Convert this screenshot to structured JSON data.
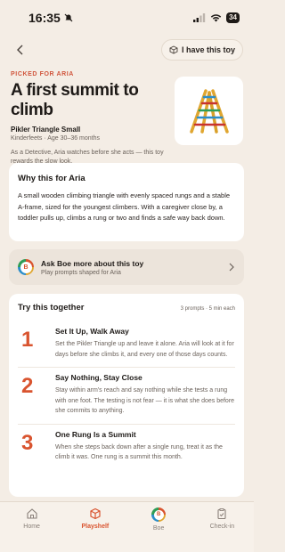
{
  "status": {
    "time": "16:35",
    "battery": "34"
  },
  "topbar": {
    "have_toy_label": "I have this toy"
  },
  "hero": {
    "eyebrow": "PICKED FOR ARIA",
    "title": "A first summit to climb",
    "product_name": "Pikler Triangle Small",
    "product_meta": "Kinderfeets · Age 30–36 months",
    "blurb": "As a Detective, Aria watches before she acts — this toy rewards the slow look."
  },
  "why": {
    "title": "Why this for Aria",
    "body": "A small wooden climbing triangle with evenly spaced rungs and a stable A-frame, sized for the youngest climbers. With a caregiver close by, a toddler pulls up, climbs a rung or two and finds a safe way back down."
  },
  "ask": {
    "title": "Ask Boe more about this toy",
    "subtitle": "Play prompts shaped for Aria",
    "avatar_letter": "B"
  },
  "try": {
    "title": "Try this together",
    "meta": "3 prompts · 5 min each",
    "steps": [
      {
        "num": "1",
        "title": "Set It Up, Walk Away",
        "text": "Set the Pikler Triangle up and leave it alone. Aria will look at it for days before she climbs it, and every one of those days counts."
      },
      {
        "num": "2",
        "title": "Say Nothing, Stay Close",
        "text": "Stay within arm's reach and say nothing while she tests a rung with one foot. The testing is not fear — it is what she does before she commits to anything."
      },
      {
        "num": "3",
        "title": "One Rung Is a Summit",
        "text": "When she steps back down after a single rung, treat it as the climb it was. One rung is a summit this month."
      }
    ]
  },
  "tabs": [
    {
      "label": "Home",
      "icon": "home-icon",
      "active": false
    },
    {
      "label": "Playshelf",
      "icon": "box-icon",
      "active": true
    },
    {
      "label": "Boe",
      "icon": "boe-icon",
      "active": false
    },
    {
      "label": "Check-in",
      "icon": "clipboard-icon",
      "active": false
    }
  ],
  "colors": {
    "accent": "#d9542f",
    "background": "#f4ede5",
    "card": "#ffffff"
  }
}
